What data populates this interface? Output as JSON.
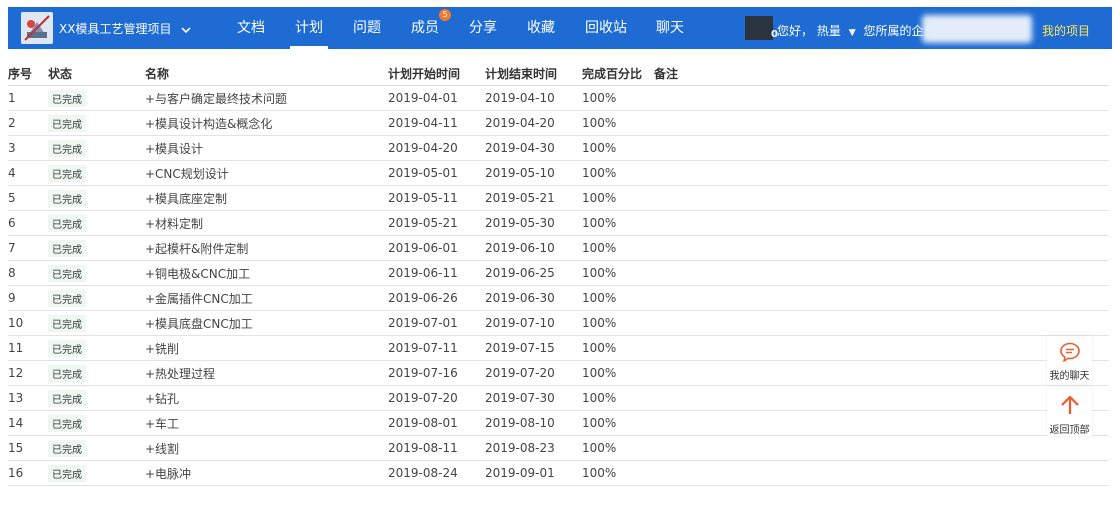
{
  "header": {
    "project_name": "XX模具工艺管理项目",
    "nav": [
      {
        "label": "文档"
      },
      {
        "label": "计划"
      },
      {
        "label": "问题"
      },
      {
        "label": "成员",
        "badge": "5"
      },
      {
        "label": "分享"
      },
      {
        "label": "收藏"
      },
      {
        "label": "回收站"
      },
      {
        "label": "聊天"
      }
    ],
    "active_tab": "计划",
    "avatar_count": "0",
    "greeting": "您好，",
    "username": "热量",
    "company_label": "您所属的企业",
    "my_projects": "我的项目",
    "colors": {
      "bar": "#1d6bd3",
      "badge": "#f07a2c",
      "my_projects": "#ffe35a"
    }
  },
  "table": {
    "columns": [
      "序号",
      "状态",
      "名称",
      "计划开始时间",
      "计划结束时间",
      "完成百分比",
      "备注"
    ],
    "rows": [
      {
        "no": "1",
        "status": "已完成",
        "name": "+与客户确定最终技术问题",
        "start": "2019-04-01",
        "end": "2019-04-10",
        "pct": "100%"
      },
      {
        "no": "2",
        "status": "已完成",
        "name": "+模具设计构造&概念化",
        "start": "2019-04-11",
        "end": "2019-04-20",
        "pct": "100%"
      },
      {
        "no": "3",
        "status": "已完成",
        "name": "+模具设计",
        "start": "2019-04-20",
        "end": "2019-04-30",
        "pct": "100%"
      },
      {
        "no": "4",
        "status": "已完成",
        "name": "+CNC规划设计",
        "start": "2019-05-01",
        "end": "2019-05-10",
        "pct": "100%"
      },
      {
        "no": "5",
        "status": "已完成",
        "name": "+模具底座定制",
        "start": "2019-05-11",
        "end": "2019-05-21",
        "pct": "100%"
      },
      {
        "no": "6",
        "status": "已完成",
        "name": "+材料定制",
        "start": "2019-05-21",
        "end": "2019-05-30",
        "pct": "100%"
      },
      {
        "no": "7",
        "status": "已完成",
        "name": "+起模杆&附件定制",
        "start": "2019-06-01",
        "end": "2019-06-10",
        "pct": "100%"
      },
      {
        "no": "8",
        "status": "已完成",
        "name": "+铜电极&CNC加工",
        "start": "2019-06-11",
        "end": "2019-06-25",
        "pct": "100%"
      },
      {
        "no": "9",
        "status": "已完成",
        "name": "+金属插件CNC加工",
        "start": "2019-06-26",
        "end": "2019-06-30",
        "pct": "100%"
      },
      {
        "no": "10",
        "status": "已完成",
        "name": "+模具底盘CNC加工",
        "start": "2019-07-01",
        "end": "2019-07-10",
        "pct": "100%"
      },
      {
        "no": "11",
        "status": "已完成",
        "name": "+铣削",
        "start": "2019-07-11",
        "end": "2019-07-15",
        "pct": "100%"
      },
      {
        "no": "12",
        "status": "已完成",
        "name": "+热处理过程",
        "start": "2019-07-16",
        "end": "2019-07-20",
        "pct": "100%"
      },
      {
        "no": "13",
        "status": "已完成",
        "name": "+钻孔",
        "start": "2019-07-20",
        "end": "2019-07-30",
        "pct": "100%"
      },
      {
        "no": "14",
        "status": "已完成",
        "name": "+车工",
        "start": "2019-08-01",
        "end": "2019-08-10",
        "pct": "100%"
      },
      {
        "no": "15",
        "status": "已完成",
        "name": "+线割",
        "start": "2019-08-11",
        "end": "2019-08-23",
        "pct": "100%"
      },
      {
        "no": "16",
        "status": "已完成",
        "name": "+电脉冲",
        "start": "2019-08-24",
        "end": "2019-09-01",
        "pct": "100%"
      }
    ]
  },
  "floating": {
    "chat_label": "我的聊天",
    "top_label": "返回顶部",
    "icons": [
      "chat-bubble-icon",
      "arrow-up-icon"
    ],
    "accent": "#f05a28"
  }
}
